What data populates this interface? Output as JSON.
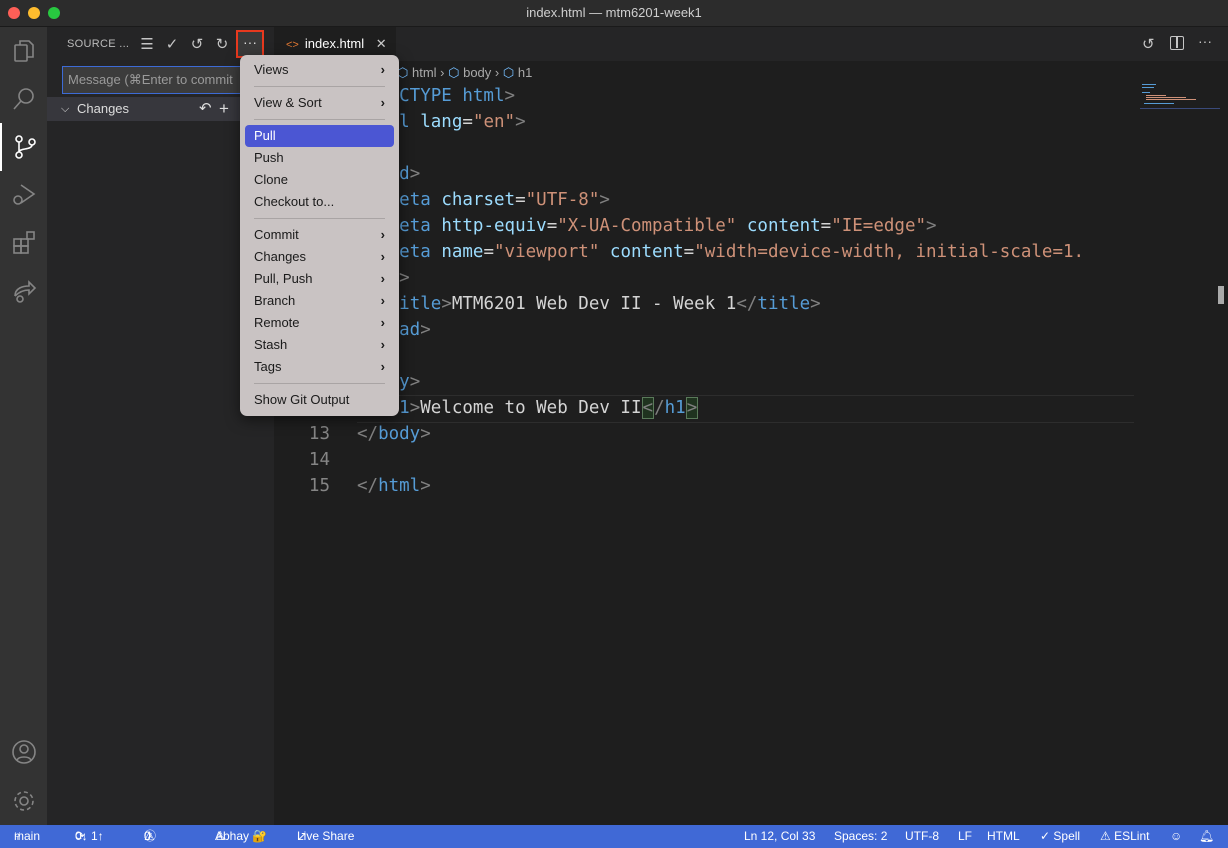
{
  "window": {
    "title": "index.html — mtm6201-week1"
  },
  "activity_bar": {
    "items": [
      "explorer-icon",
      "search-icon",
      "source-control-icon",
      "run-debug-icon",
      "extensions-icon",
      "live-share-icon"
    ],
    "bottom": [
      "account-icon",
      "settings-gear-icon"
    ]
  },
  "sidebar": {
    "title": "SOURCE ...",
    "commit_placeholder": "Message (⌘Enter to commit",
    "changes_label": "Changes"
  },
  "tab": {
    "label": "index.html"
  },
  "breadcrumb": [
    "html",
    "body",
    "h1"
  ],
  "editor": {
    "lines": [
      {
        "n": "",
        "parts": [
          [
            "p",
            "<!"
          ],
          [
            "t",
            "DOCTYPE html"
          ],
          [
            "p",
            ">"
          ]
        ]
      },
      {
        "n": "",
        "parts": [
          [
            "p",
            "<"
          ],
          [
            "t",
            "html"
          ],
          [
            "a",
            " lang"
          ],
          [
            "",
            "="
          ],
          [
            "s",
            "\"en\""
          ],
          [
            "p",
            ">"
          ]
        ]
      },
      {
        "n": "",
        "parts": []
      },
      {
        "n": "",
        "parts": [
          [
            "p",
            "<"
          ],
          [
            "t",
            "head"
          ],
          [
            "p",
            ">"
          ]
        ]
      },
      {
        "n": "",
        "parts": [
          [
            "",
            "  "
          ],
          [
            "p",
            "<"
          ],
          [
            "t",
            "meta"
          ],
          [
            "a",
            " charset"
          ],
          [
            "",
            "="
          ],
          [
            "s",
            "\"UTF-8\""
          ],
          [
            "p",
            ">"
          ]
        ]
      },
      {
        "n": "",
        "parts": [
          [
            "",
            "  "
          ],
          [
            "p",
            "<"
          ],
          [
            "t",
            "meta"
          ],
          [
            "a",
            " http-equiv"
          ],
          [
            "",
            "="
          ],
          [
            "s",
            "\"X-UA-Compatible\""
          ],
          [
            "a",
            " content"
          ],
          [
            "",
            "="
          ],
          [
            "s",
            "\"IE=edge\""
          ],
          [
            "p",
            ">"
          ]
        ]
      },
      {
        "n": "",
        "parts": [
          [
            "",
            "  "
          ],
          [
            "p",
            "<"
          ],
          [
            "t",
            "meta"
          ],
          [
            "a",
            " name"
          ],
          [
            "",
            "="
          ],
          [
            "s",
            "\"viewport\""
          ],
          [
            "a",
            " content"
          ],
          [
            "",
            "="
          ],
          [
            "s",
            "\"width=device-width, initial-scale=1."
          ]
        ]
      },
      {
        "n": "",
        "parts": [
          [
            "",
            "    "
          ],
          [
            "p",
            ">"
          ]
        ]
      },
      {
        "n": "",
        "parts": [
          [
            "",
            "  "
          ],
          [
            "p",
            "<"
          ],
          [
            "t",
            "title"
          ],
          [
            "p",
            ">"
          ],
          [
            "",
            "MTM6201 Web Dev II - Week 1"
          ],
          [
            "p",
            "</"
          ],
          [
            "t",
            "title"
          ],
          [
            "p",
            ">"
          ]
        ]
      },
      {
        "n": "",
        "parts": [
          [
            "p",
            "</"
          ],
          [
            "t",
            "head"
          ],
          [
            "p",
            ">"
          ]
        ]
      },
      {
        "n": "",
        "parts": []
      },
      {
        "n": "",
        "parts": [
          [
            "p",
            "<"
          ],
          [
            "t",
            "body"
          ],
          [
            "p",
            ">"
          ]
        ]
      },
      {
        "n": "",
        "parts": [
          [
            "",
            "  "
          ],
          [
            "p",
            "<"
          ],
          [
            "t",
            "h1"
          ],
          [
            "p",
            ">"
          ],
          [
            "",
            "Welcome to Web Dev II"
          ],
          [
            "pb",
            "<"
          ],
          [
            "p",
            "/"
          ],
          [
            "t",
            "h1"
          ],
          [
            "pb",
            ">"
          ]
        ]
      },
      {
        "n": "13",
        "parts": [
          [
            "p",
            "</"
          ],
          [
            "t",
            "body"
          ],
          [
            "p",
            ">"
          ]
        ]
      },
      {
        "n": "14",
        "parts": []
      },
      {
        "n": "15",
        "parts": [
          [
            "p",
            "</"
          ],
          [
            "t",
            "html"
          ],
          [
            "p",
            ">"
          ]
        ]
      }
    ]
  },
  "menu": {
    "items": [
      {
        "label": "Views",
        "sub": true
      },
      {
        "sep": true
      },
      {
        "label": "View & Sort",
        "sub": true
      },
      {
        "sep": true
      },
      {
        "label": "Pull",
        "highlighted": true
      },
      {
        "label": "Push"
      },
      {
        "label": "Clone"
      },
      {
        "label": "Checkout to..."
      },
      {
        "sep": true
      },
      {
        "label": "Commit",
        "sub": true
      },
      {
        "label": "Changes",
        "sub": true
      },
      {
        "label": "Pull, Push",
        "sub": true
      },
      {
        "label": "Branch",
        "sub": true
      },
      {
        "label": "Remote",
        "sub": true
      },
      {
        "label": "Stash",
        "sub": true
      },
      {
        "label": "Tags",
        "sub": true
      },
      {
        "sep": true
      },
      {
        "label": "Show Git Output"
      }
    ]
  },
  "status": {
    "branch": "main",
    "sync": "0↓ 1↑",
    "errors": "0",
    "warnings": "0",
    "user": "Abhay 🔐",
    "live_share": "Live Share",
    "position": "Ln 12, Col 33",
    "spaces": "Spaces: 2",
    "encoding": "UTF-8",
    "eol": "LF",
    "language": "HTML",
    "spell": "✓ Spell",
    "eslint": "⚠ ESLint"
  },
  "colors": {
    "status_bar": "#4069d6",
    "menu_highlight": "#4b56d3",
    "focus_outline": "#e8391e"
  }
}
